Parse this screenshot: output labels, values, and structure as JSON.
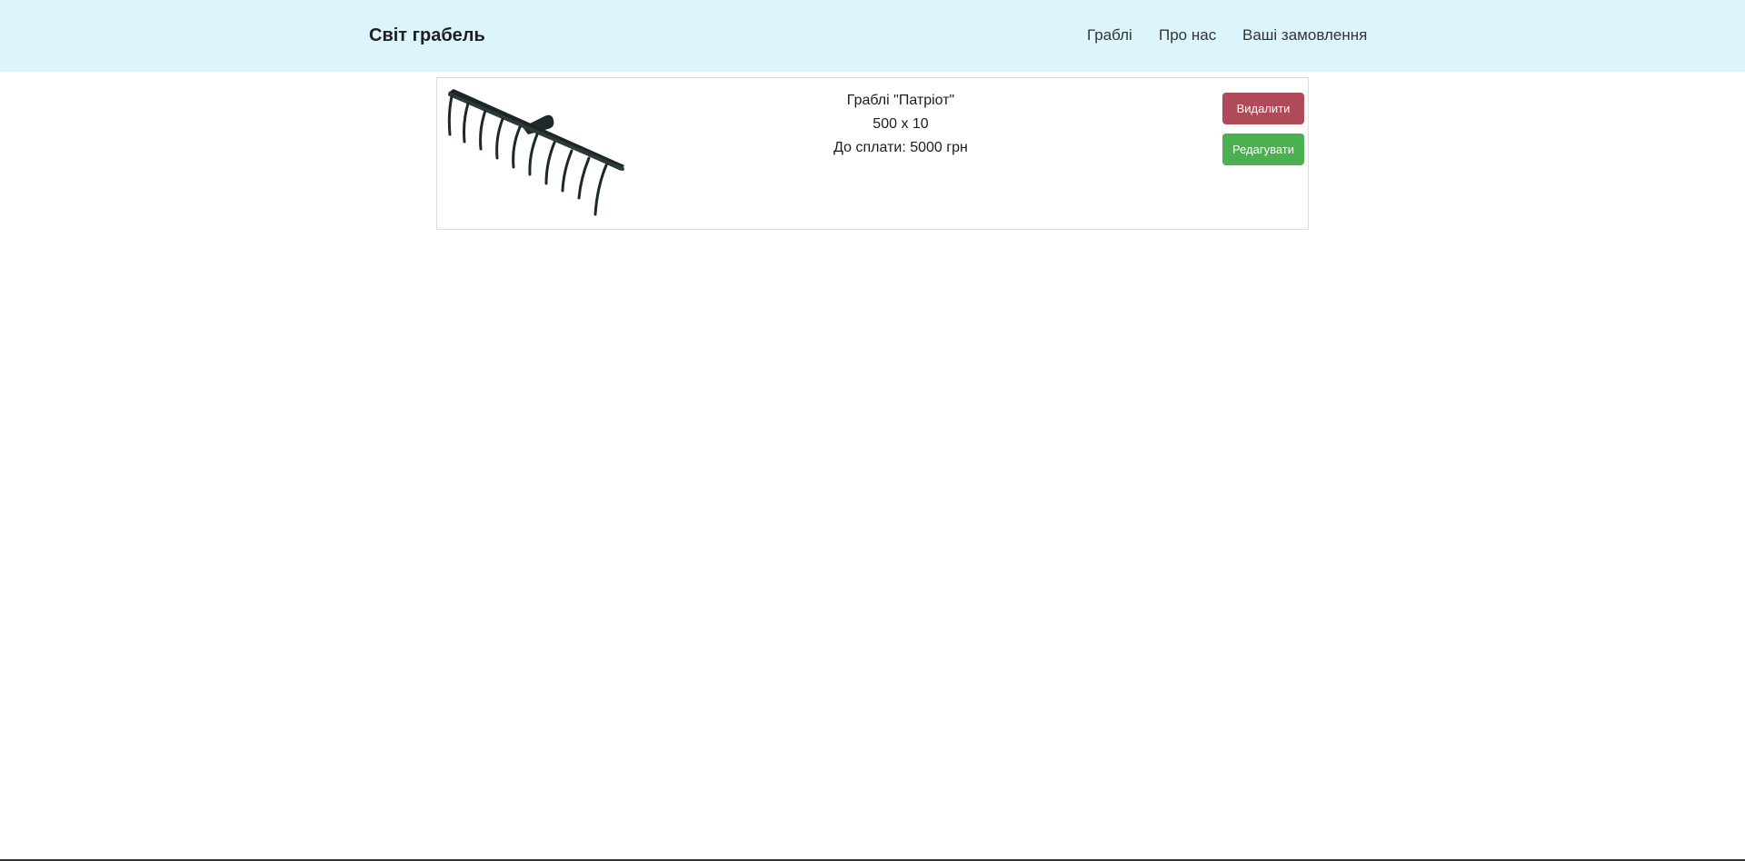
{
  "navbar": {
    "brand": "Світ грабель",
    "links": [
      {
        "label": "Граблі"
      },
      {
        "label": "Про нас"
      },
      {
        "label": "Ваші замовлення"
      }
    ]
  },
  "order": {
    "image_icon": "rake-image",
    "product_name": "Граблі \"Патріот\"",
    "dimensions": "500 x 10",
    "price_text": "До сплати: 5000 грн",
    "delete_label": "Видалити",
    "edit_label": "Редагувати"
  },
  "colors": {
    "navbar_bg": "#dcf5fc",
    "delete_button": "#b04a58",
    "edit_button": "#4caf50"
  }
}
